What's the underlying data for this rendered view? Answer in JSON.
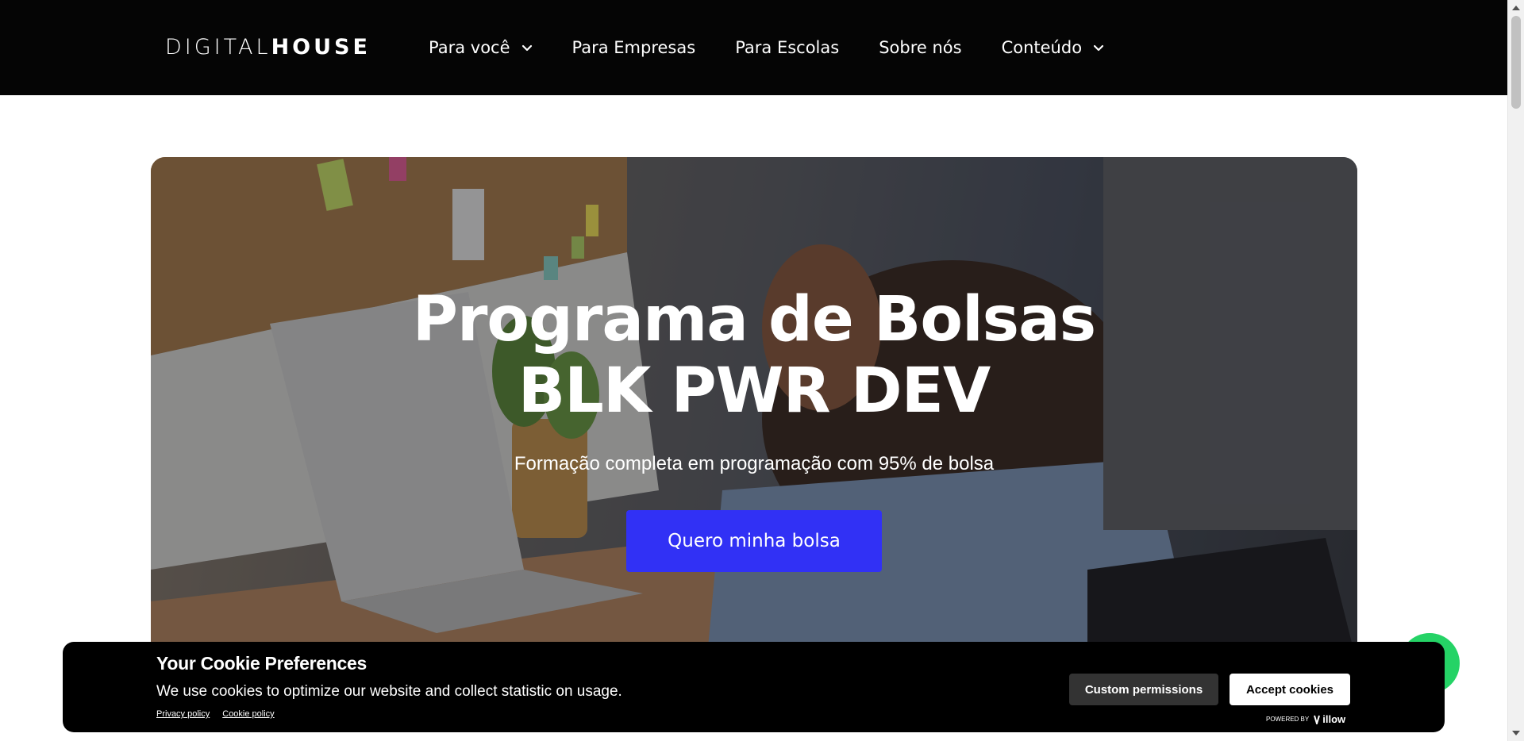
{
  "header": {
    "logo_light": "DIGITAL",
    "logo_bold": "HOUSE",
    "nav": [
      {
        "label": "Para você",
        "has_dropdown": true
      },
      {
        "label": "Para Empresas",
        "has_dropdown": false
      },
      {
        "label": "Para Escolas",
        "has_dropdown": false
      },
      {
        "label": "Sobre nós",
        "has_dropdown": false
      },
      {
        "label": "Conteúdo",
        "has_dropdown": true
      }
    ]
  },
  "hero": {
    "title_line1": "Programa de Bolsas",
    "title_line2": "BLK PWR DEV",
    "subtitle": "Formação completa em programação com 95% de bolsa",
    "cta_label": "Quero minha bolsa"
  },
  "cookie_banner": {
    "title": "Your Cookie Preferences",
    "text": "We use cookies to optimize our website and collect statistic on usage.",
    "links": [
      "Privacy policy",
      "Cookie policy"
    ],
    "custom_label": "Custom permissions",
    "accept_label": "Accept cookies",
    "powered_by": "POWERED BY",
    "powered_brand": "illow"
  },
  "colors": {
    "header_bg": "#050505",
    "cta_bg": "#3131f5",
    "whatsapp": "#25d366"
  }
}
